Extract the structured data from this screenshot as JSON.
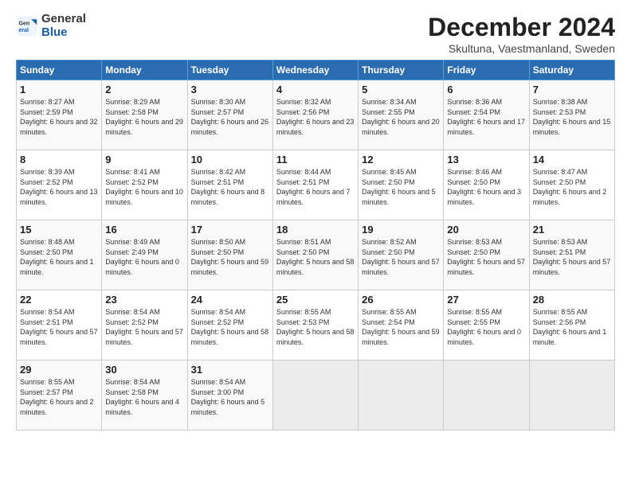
{
  "header": {
    "logo_general": "General",
    "logo_blue": "Blue",
    "month_title": "December 2024",
    "subtitle": "Skultuna, Vaestmanland, Sweden"
  },
  "days_of_week": [
    "Sunday",
    "Monday",
    "Tuesday",
    "Wednesday",
    "Thursday",
    "Friday",
    "Saturday"
  ],
  "weeks": [
    [
      {
        "day": "1",
        "sunrise": "8:27 AM",
        "sunset": "2:59 PM",
        "daylight": "6 hours and 32 minutes."
      },
      {
        "day": "2",
        "sunrise": "8:29 AM",
        "sunset": "2:58 PM",
        "daylight": "6 hours and 29 minutes."
      },
      {
        "day": "3",
        "sunrise": "8:30 AM",
        "sunset": "2:57 PM",
        "daylight": "6 hours and 26 minutes."
      },
      {
        "day": "4",
        "sunrise": "8:32 AM",
        "sunset": "2:56 PM",
        "daylight": "6 hours and 23 minutes."
      },
      {
        "day": "5",
        "sunrise": "8:34 AM",
        "sunset": "2:55 PM",
        "daylight": "6 hours and 20 minutes."
      },
      {
        "day": "6",
        "sunrise": "8:36 AM",
        "sunset": "2:54 PM",
        "daylight": "6 hours and 17 minutes."
      },
      {
        "day": "7",
        "sunrise": "8:38 AM",
        "sunset": "2:53 PM",
        "daylight": "6 hours and 15 minutes."
      }
    ],
    [
      {
        "day": "8",
        "sunrise": "8:39 AM",
        "sunset": "2:52 PM",
        "daylight": "6 hours and 13 minutes."
      },
      {
        "day": "9",
        "sunrise": "8:41 AM",
        "sunset": "2:52 PM",
        "daylight": "6 hours and 10 minutes."
      },
      {
        "day": "10",
        "sunrise": "8:42 AM",
        "sunset": "2:51 PM",
        "daylight": "6 hours and 8 minutes."
      },
      {
        "day": "11",
        "sunrise": "8:44 AM",
        "sunset": "2:51 PM",
        "daylight": "6 hours and 7 minutes."
      },
      {
        "day": "12",
        "sunrise": "8:45 AM",
        "sunset": "2:50 PM",
        "daylight": "6 hours and 5 minutes."
      },
      {
        "day": "13",
        "sunrise": "8:46 AM",
        "sunset": "2:50 PM",
        "daylight": "6 hours and 3 minutes."
      },
      {
        "day": "14",
        "sunrise": "8:47 AM",
        "sunset": "2:50 PM",
        "daylight": "6 hours and 2 minutes."
      }
    ],
    [
      {
        "day": "15",
        "sunrise": "8:48 AM",
        "sunset": "2:50 PM",
        "daylight": "6 hours and 1 minute."
      },
      {
        "day": "16",
        "sunrise": "8:49 AM",
        "sunset": "2:49 PM",
        "daylight": "6 hours and 0 minutes."
      },
      {
        "day": "17",
        "sunrise": "8:50 AM",
        "sunset": "2:50 PM",
        "daylight": "5 hours and 59 minutes."
      },
      {
        "day": "18",
        "sunrise": "8:51 AM",
        "sunset": "2:50 PM",
        "daylight": "5 hours and 58 minutes."
      },
      {
        "day": "19",
        "sunrise": "8:52 AM",
        "sunset": "2:50 PM",
        "daylight": "5 hours and 57 minutes."
      },
      {
        "day": "20",
        "sunrise": "8:53 AM",
        "sunset": "2:50 PM",
        "daylight": "5 hours and 57 minutes."
      },
      {
        "day": "21",
        "sunrise": "8:53 AM",
        "sunset": "2:51 PM",
        "daylight": "5 hours and 57 minutes."
      }
    ],
    [
      {
        "day": "22",
        "sunrise": "8:54 AM",
        "sunset": "2:51 PM",
        "daylight": "5 hours and 57 minutes."
      },
      {
        "day": "23",
        "sunrise": "8:54 AM",
        "sunset": "2:52 PM",
        "daylight": "5 hours and 57 minutes."
      },
      {
        "day": "24",
        "sunrise": "8:54 AM",
        "sunset": "2:52 PM",
        "daylight": "5 hours and 58 minutes."
      },
      {
        "day": "25",
        "sunrise": "8:55 AM",
        "sunset": "2:53 PM",
        "daylight": "5 hours and 58 minutes."
      },
      {
        "day": "26",
        "sunrise": "8:55 AM",
        "sunset": "2:54 PM",
        "daylight": "5 hours and 59 minutes."
      },
      {
        "day": "27",
        "sunrise": "8:55 AM",
        "sunset": "2:55 PM",
        "daylight": "6 hours and 0 minutes."
      },
      {
        "day": "28",
        "sunrise": "8:55 AM",
        "sunset": "2:56 PM",
        "daylight": "6 hours and 1 minute."
      }
    ],
    [
      {
        "day": "29",
        "sunrise": "8:55 AM",
        "sunset": "2:57 PM",
        "daylight": "6 hours and 2 minutes."
      },
      {
        "day": "30",
        "sunrise": "8:54 AM",
        "sunset": "2:58 PM",
        "daylight": "6 hours and 4 minutes."
      },
      {
        "day": "31",
        "sunrise": "8:54 AM",
        "sunset": "3:00 PM",
        "daylight": "6 hours and 5 minutes."
      },
      null,
      null,
      null,
      null
    ]
  ]
}
